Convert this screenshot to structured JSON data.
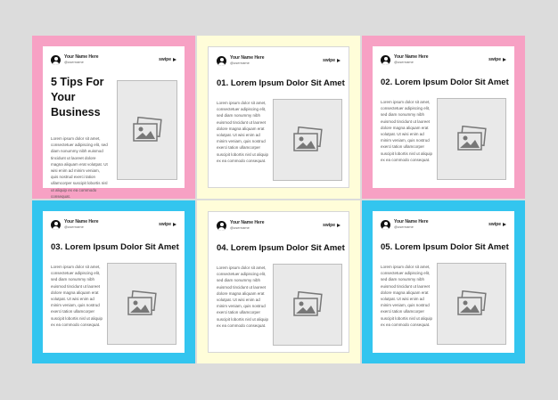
{
  "colors": {
    "background": "#dcdcdc",
    "pink": "#f7a1c4",
    "cream": "#fffdd9",
    "blue": "#33c5ef",
    "white": "#ffffff"
  },
  "profile": {
    "name": "Your Name Here",
    "handle": "@username",
    "swipe_label": "swipe"
  },
  "intro": {
    "title": "5 Tips For Your Business",
    "body": "Lorem ipsum dolor sit amet, consectetuer adipiscing elit, sed diam nonummy nibh euismod tincidunt ut laoreet dolore magna aliquam erat volutpat. Ut wisi enim ad minim veniam, quis nostrud exerci tation ullamcorper suscipit lobortis nisl ut aliquip ex ea commodo consequat."
  },
  "tips": [
    {
      "title": "01. Lorem Ipsum Dolor Sit Amet",
      "body": "Lorem ipsum dolor sit amet, consectetuer adipiscing elit, sed diam nonummy nibh euismod tincidunt ut laoreet dolore magna aliquam erat volutpat. Ut wisi enim ad minim veniam, quis nostrud exerci tation ullamcorper suscipit lobortis nisl ut aliquip ex ea commodo consequat."
    },
    {
      "title": "02. Lorem Ipsum Dolor Sit Amet",
      "body": "Lorem ipsum dolor sit amet, consectetuer adipiscing elit, sed diam nonummy nibh euismod tincidunt ut laoreet dolore magna aliquam erat volutpat. Ut wisi enim ad minim veniam, quis nostrud exerci tation ullamcorper suscipit lobortis nisl ut aliquip ex ea commodo consequat."
    },
    {
      "title": "03. Lorem Ipsum Dolor Sit Amet",
      "body": "Lorem ipsum dolor sit amet, consectetuer adipiscing elit, sed diam nonummy nibh euismod tincidunt ut laoreet dolore magna aliquam erat volutpat. Ut wisi enim ad minim veniam, quis nostrud exerci tation ullamcorper suscipit lobortis nisl ut aliquip ex ea commodo consequat."
    },
    {
      "title": "04. Lorem Ipsum Dolor Sit Amet",
      "body": "Lorem ipsum dolor sit amet, consectetuer adipiscing elit, sed diam nonummy nibh euismod tincidunt ut laoreet dolore magna aliquam erat volutpat. Ut wisi enim ad minim veniam, quis nostrud exerci tation ullamcorper suscipit lobortis nisl ut aliquip ex ea commodo consequat."
    },
    {
      "title": "05. Lorem Ipsum Dolor Sit Amet",
      "body": "Lorem ipsum dolor sit amet, consectetuer adipiscing elit, sed diam nonummy nibh euismod tincidunt ut laoreet dolore magna aliquam erat volutpat. Ut wisi enim ad minim veniam, quis nostrud exerci tation ullamcorper suscipit lobortis nisl ut aliquip ex ea commodo consequat."
    }
  ],
  "icons": [
    "user-avatar-icon",
    "arrow-right-icon",
    "image-placeholder-icon"
  ]
}
